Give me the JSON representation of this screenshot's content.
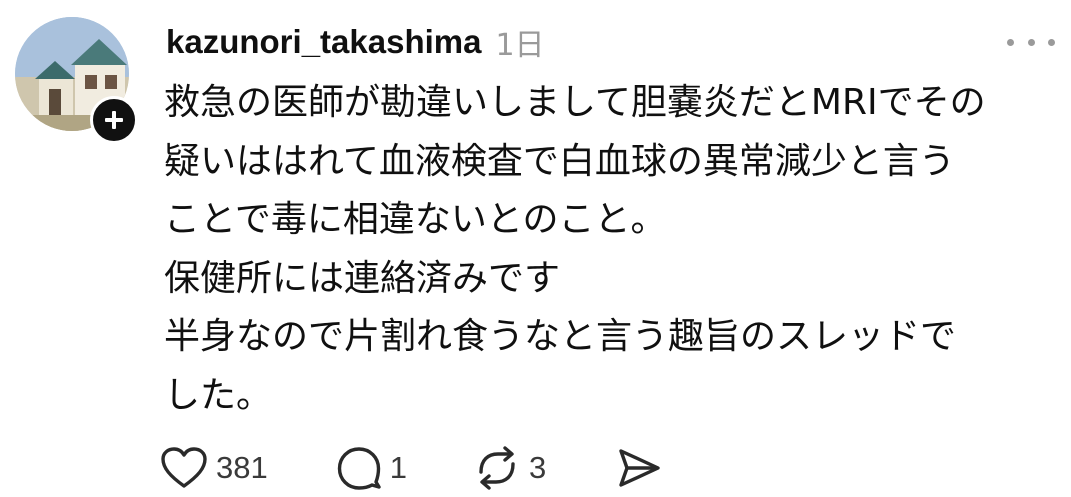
{
  "post": {
    "username": "kazunori_takashima",
    "timestamp": "1日",
    "body_lines": [
      "救急の医師が勘違いしまして胆嚢炎だとMRIでその",
      "疑いははれて血液検査で白血球の異常減少と言う",
      "ことで毒に相違ないとのこと。",
      "保健所には連絡済みです",
      "半身なので片割れ食うなと言う趣旨のスレッドで",
      "した。"
    ],
    "actions": {
      "like_count": "381",
      "reply_count": "1",
      "repost_count": "3"
    }
  },
  "icons": {
    "avatar": "avatar-photo",
    "follow": "plus-icon",
    "more": "more-dots-icon",
    "like": "heart-icon",
    "reply": "comment-icon",
    "repost": "repost-icon",
    "share": "send-icon"
  },
  "colors": {
    "text": "#101010",
    "muted": "#9a9a9a",
    "badge": "#111111"
  }
}
